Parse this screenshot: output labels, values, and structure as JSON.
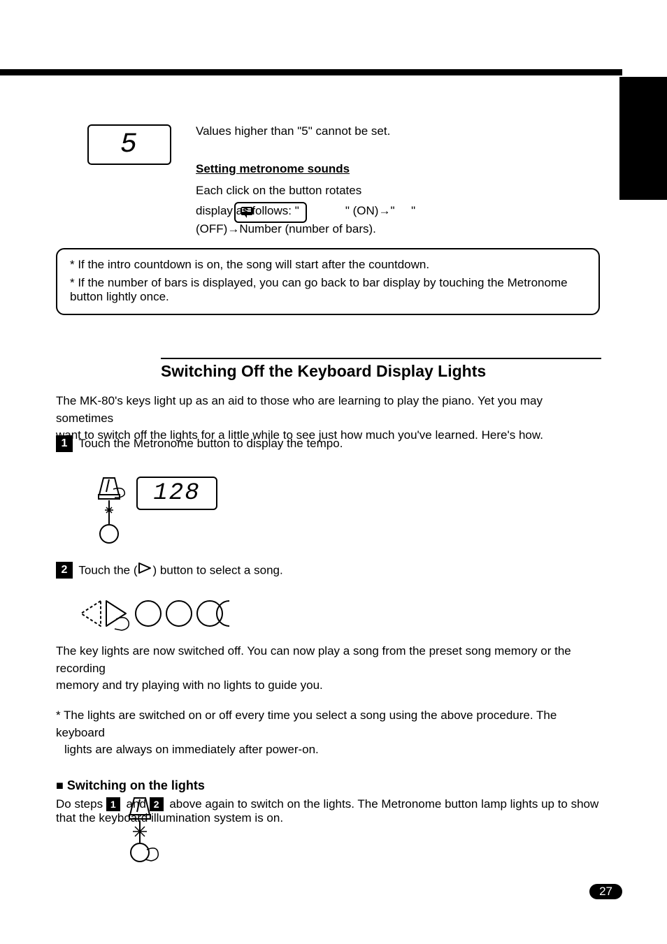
{
  "lcd": {
    "disp1": "5",
    "disp3": "128"
  },
  "block1": {
    "line1_pre": "Values higher than \"",
    "line1_post": "\" cannot be set.",
    "line2": "Setting metronome sounds",
    "line3": "Each click on the button rotates",
    "line4_a": "display as follows: \"",
    "line4_b": "\" (ON)→\"",
    "line4_c": "\"",
    "line5": "(OFF)→Number (number of bars)."
  },
  "note": {
    "line1": "* If the intro countdown is on, the song will start after the countdown.",
    "line2_a": "* If the number of bars is displayed, you can go back to bar display by touching the Metronome button",
    "line2_b": "lightly once."
  },
  "section_title": "Switching Off the Keyboard Display Lights",
  "intro": {
    "line1": "The MK-80's keys light up as an aid to those who are learning to play the piano. Yet you may sometimes",
    "line2": "want to switch off the lights for a little while to see just how much you've learned. Here's how."
  },
  "step1": {
    "text": "Touch the Metronome button to display the tempo."
  },
  "step2": {
    "text_a": "Touch the (",
    "text_b": ") button to select a song.",
    "para_a": "The key lights are now switched off. You can now play a song from the preset song memory or the recording",
    "para_b": "memory and try playing with no lights to guide you.",
    "para_c": "* The lights are switched on or off every time you select a song using the above procedure. The keyboard",
    "para_d": "lights are always on immediately after power-on."
  },
  "headside": {
    "title": "■ Switching on the lights",
    "text_a": "Do steps ",
    "text_b": " and ",
    "text_c": " above again to switch on the lights. The Metronome button lamp lights up to show",
    "text_d": "that the keyboard illumination system is on."
  },
  "page_number": "27"
}
